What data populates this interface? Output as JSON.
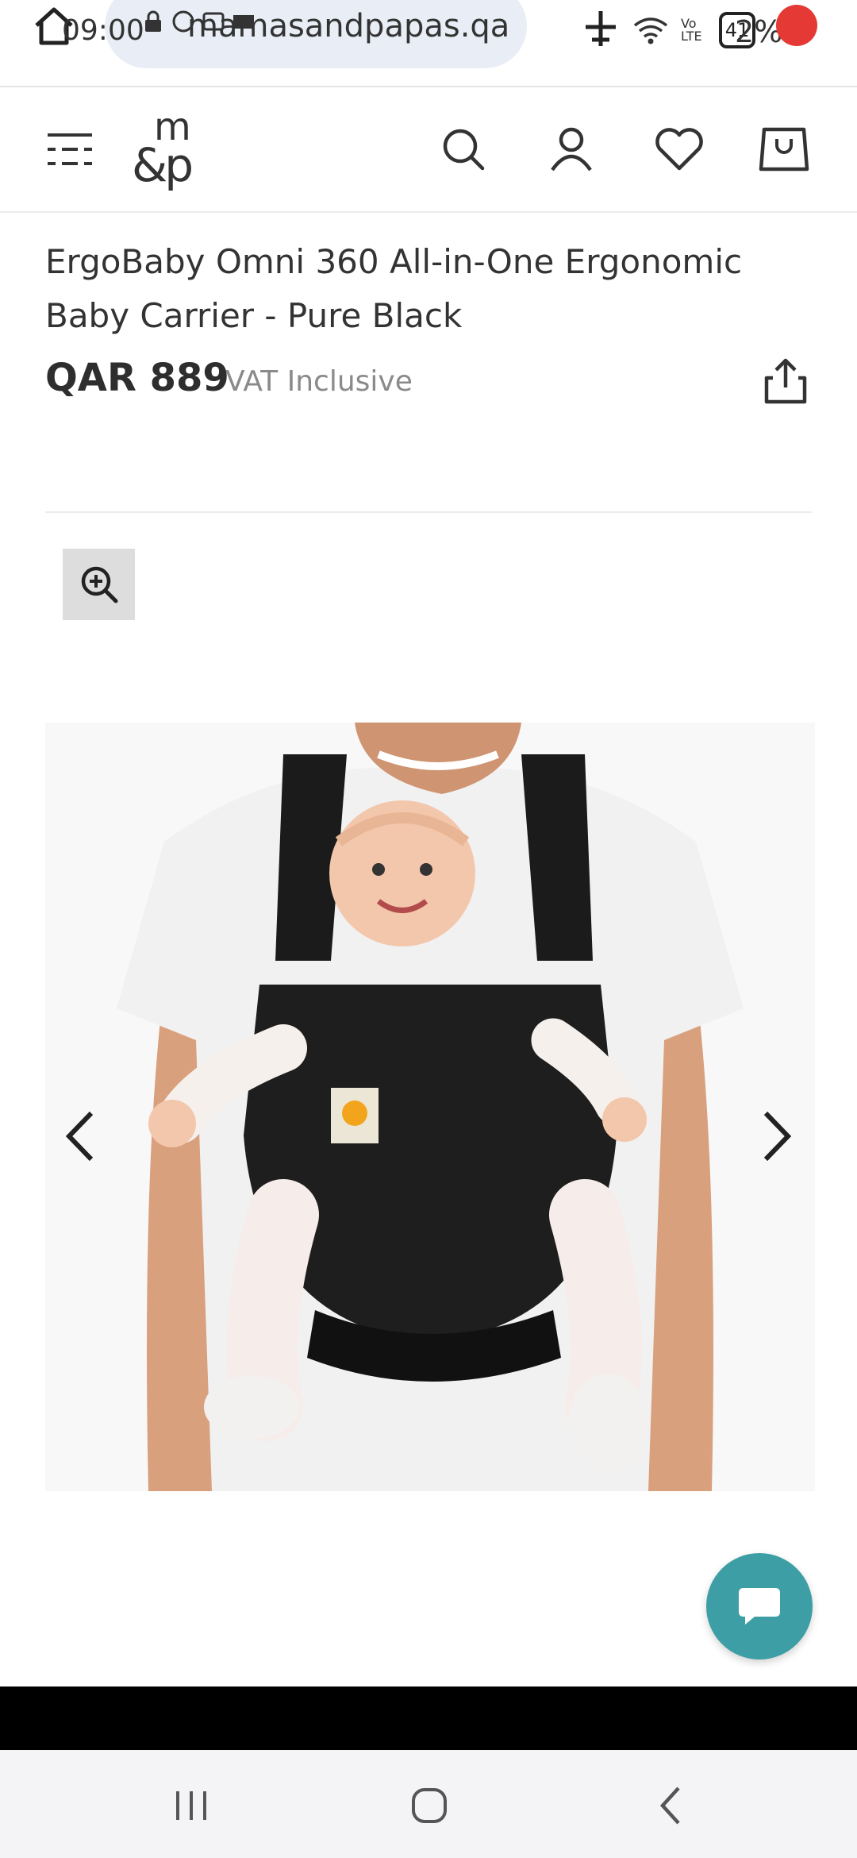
{
  "status_bar": {
    "time": "09:00",
    "url": "mamasandpapas.qa",
    "battery": "2%",
    "notification_count": "41",
    "network": "Vo LTE"
  },
  "header": {
    "logo_top": "m",
    "logo_bottom": "&p"
  },
  "product": {
    "title": "ErgoBaby Omni 360 All-in-One Ergonomic Baby Carrier - Pure Black",
    "price": "QAR 889",
    "vat_note": "VAT Inclusive"
  },
  "colors": {
    "accent_chat": "#3e9ea5",
    "zoom_bg": "#dddddd",
    "text_primary": "#333333",
    "text_muted": "#8a8a8a"
  },
  "icons": {
    "menu": "menu-icon",
    "search": "search-icon",
    "account": "user-icon",
    "wishlist": "heart-icon",
    "bag": "shopping-bag-icon",
    "share": "share-icon",
    "zoom": "zoom-in-icon",
    "prev": "chevron-left-icon",
    "next": "chevron-right-icon",
    "chat": "chat-icon"
  }
}
